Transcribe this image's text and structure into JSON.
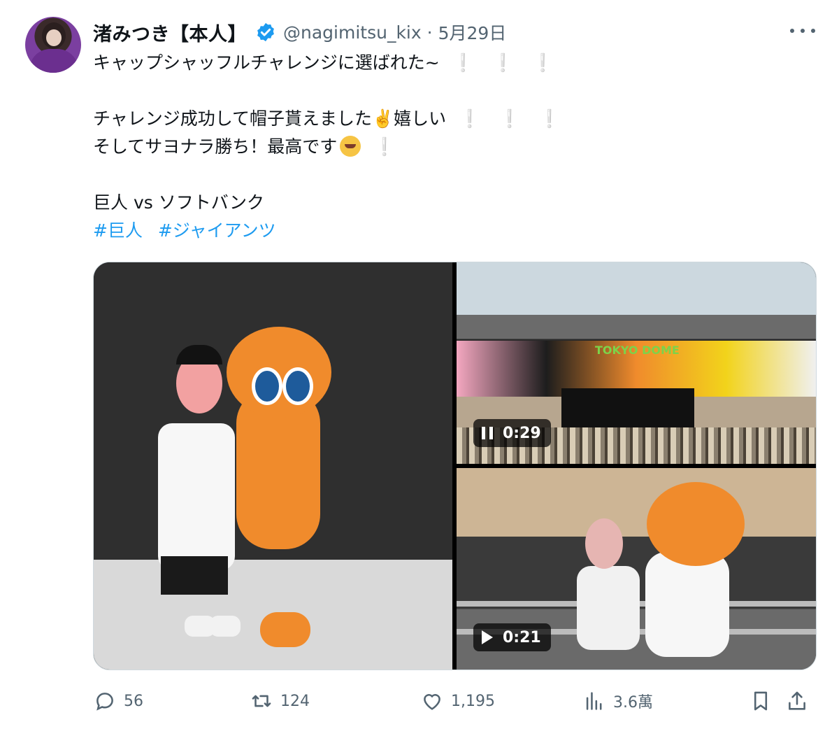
{
  "tweet": {
    "display_name": "渚みつき【本人】",
    "handle": "@nagimitsu_kix",
    "dot": "·",
    "date": "5月29日",
    "lines": [
      "キャップシャッフルチャレンジに選ばれた~",
      "",
      "チャレンジ成功して帽子貰えました✌️嬉しい",
      "そしてサヨナラ勝ち！最高です",
      "",
      "巨人 vs ソフトバンク"
    ],
    "exclamation": "❕❕❕",
    "exclamation_single": "❕",
    "hashtags": [
      "#巨人",
      "#ジャイアンツ"
    ]
  },
  "media": {
    "video_top_time": "0:29",
    "video_bottom_time": "0:21",
    "video_top_state": "playing",
    "video_bottom_state": "paused",
    "scoreboard_text": "TOKYO DOME"
  },
  "actions": {
    "replies": "56",
    "retweets": "124",
    "likes": "1,195",
    "views": "3.6萬"
  },
  "colors": {
    "link": "#1d9bf0",
    "muted": "#536471",
    "text": "#0f1419",
    "verified": "#1d9bf0"
  },
  "icons": [
    "more-icon",
    "verified-icon",
    "reply-icon",
    "retweet-icon",
    "like-icon",
    "views-icon",
    "bookmark-icon",
    "share-icon",
    "pause-icon",
    "play-icon"
  ]
}
